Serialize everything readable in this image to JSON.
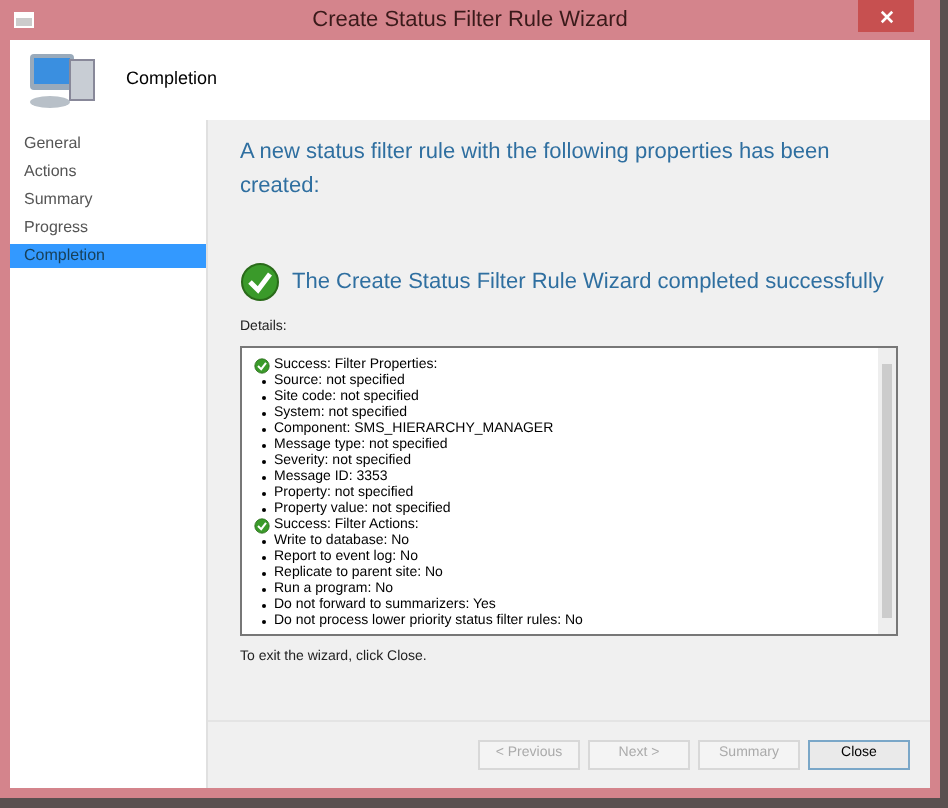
{
  "window": {
    "title": "Create Status Filter Rule Wizard"
  },
  "header": {
    "title": "Completion"
  },
  "sidebar": {
    "items": [
      {
        "label": "General",
        "selected": false
      },
      {
        "label": "Actions",
        "selected": false
      },
      {
        "label": "Summary",
        "selected": false
      },
      {
        "label": "Progress",
        "selected": false
      },
      {
        "label": "Completion",
        "selected": true
      }
    ]
  },
  "content": {
    "heading": "A new status filter rule with the following properties has been created:",
    "result": "The Create Status Filter Rule Wizard completed successfully",
    "details_label": "Details:",
    "details": [
      {
        "title": "Success: Filter Properties:",
        "items": [
          "Source: not specified",
          "Site code: not specified",
          "System: not specified",
          "Component: SMS_HIERARCHY_MANAGER",
          "Message type: not specified",
          "Severity: not specified",
          "Message ID: 3353",
          "Property: not specified",
          "Property value: not specified"
        ]
      },
      {
        "title": "Success: Filter Actions:",
        "items": [
          "Write to database: No",
          "Report to event log: No",
          "Replicate to parent site: No",
          "Run a program: No",
          "Do not forward to summarizers: Yes",
          "Do not process lower priority status filter rules: No"
        ]
      }
    ],
    "exit_note": "To exit the wizard, click Close."
  },
  "buttons": [
    {
      "label": "< Previous",
      "disabled": true
    },
    {
      "label": "Next >",
      "disabled": true
    },
    {
      "label": "Summary",
      "disabled": true
    },
    {
      "label": "Close",
      "disabled": false
    }
  ]
}
